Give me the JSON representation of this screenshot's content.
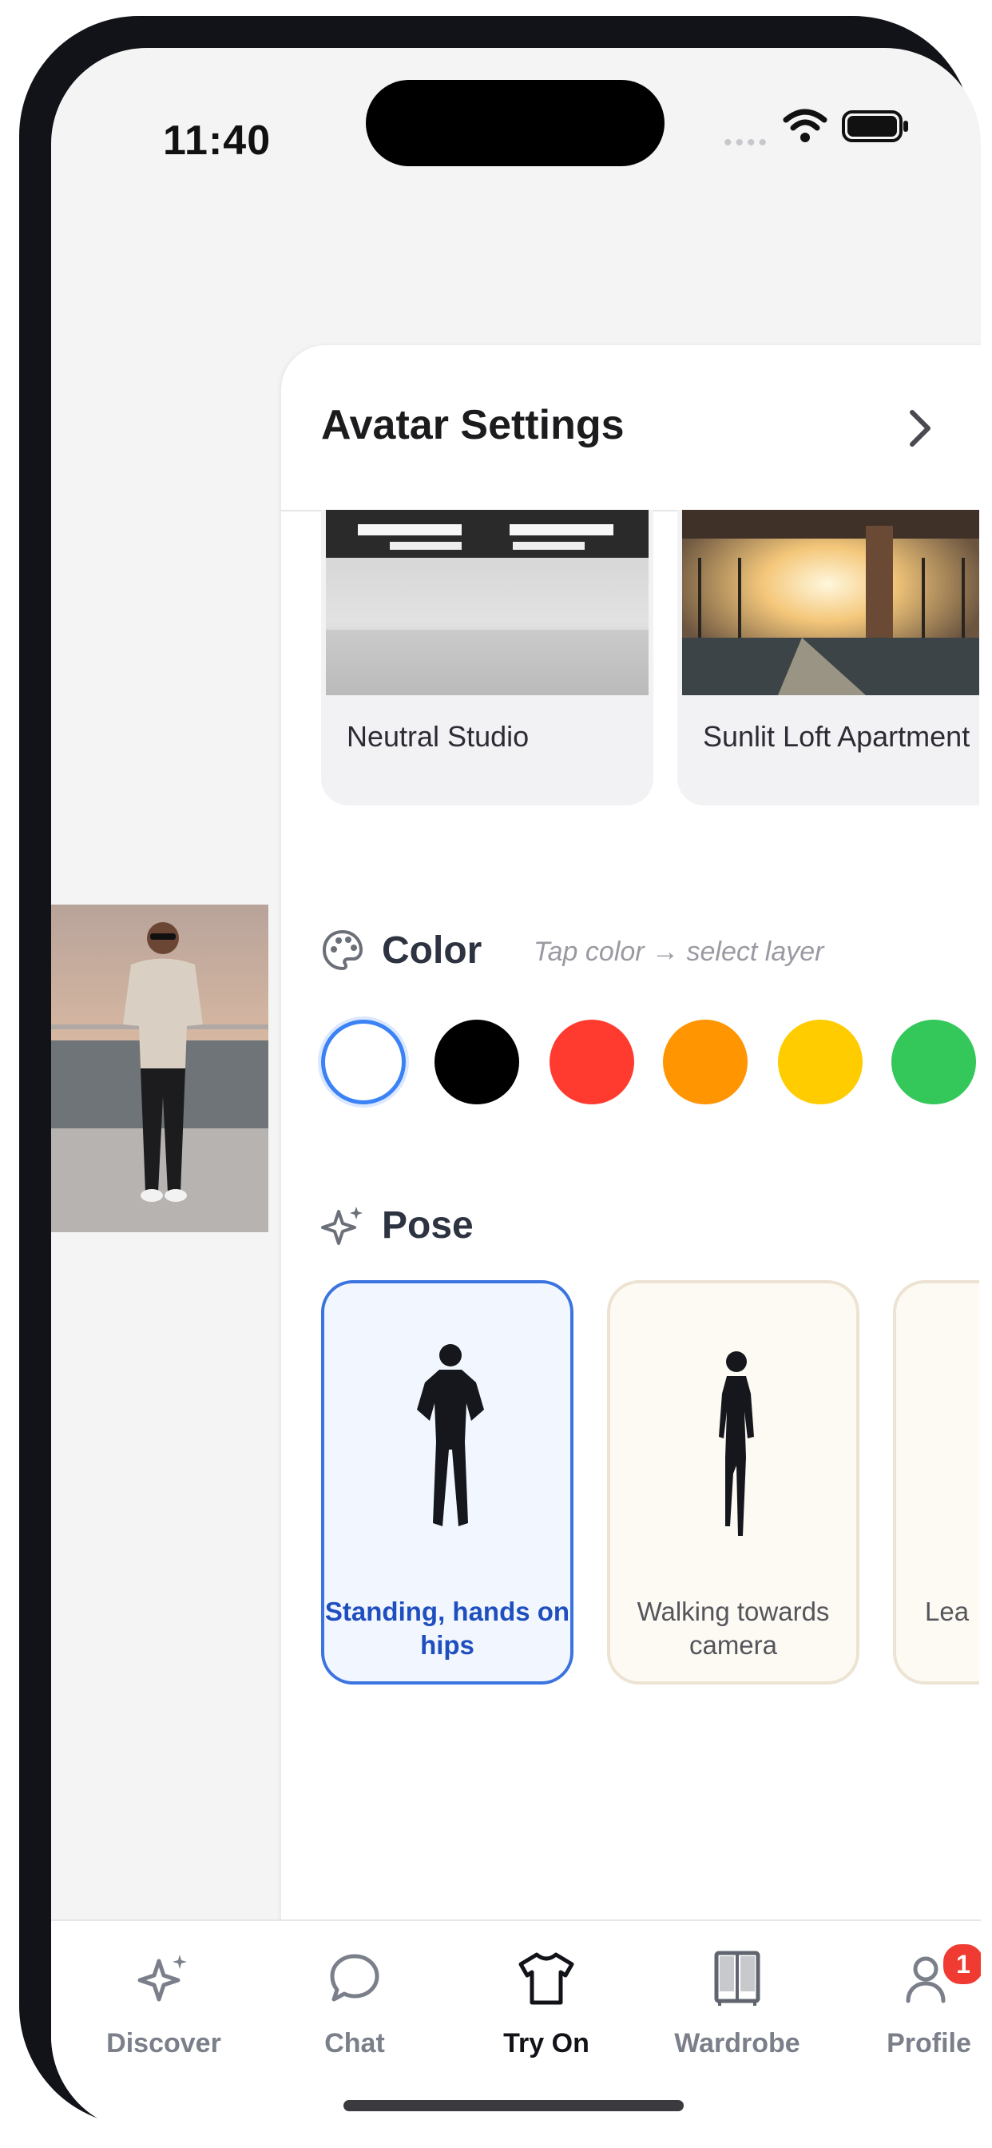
{
  "status_bar": {
    "time": "11:40"
  },
  "panel": {
    "title": "Avatar Settings",
    "backgrounds": [
      {
        "label": "Neutral Studio"
      },
      {
        "label": "Sunlit Loft Apartment"
      }
    ],
    "color": {
      "title": "Color",
      "hint": "Tap color → select layer",
      "swatches": [
        "#ffffff",
        "#000000",
        "#ff3b30",
        "#ff9500",
        "#ffcc00",
        "#34c759"
      ],
      "selected_index": 0
    },
    "pose": {
      "title": "Pose",
      "cards": [
        {
          "label": "Standing, hands on hips",
          "selected": true
        },
        {
          "label": "Walking towards camera",
          "selected": false
        },
        {
          "label": "Lea",
          "selected": false
        }
      ]
    }
  },
  "tabbar": {
    "tabs": [
      {
        "label": "Discover",
        "icon": "sparkle-icon"
      },
      {
        "label": "Chat",
        "icon": "chat-bubble-icon"
      },
      {
        "label": "Try On",
        "icon": "tshirt-icon",
        "active": true
      },
      {
        "label": "Wardrobe",
        "icon": "wardrobe-icon"
      },
      {
        "label": "Profile",
        "icon": "profile-icon",
        "badge": "1"
      }
    ]
  },
  "colors": {
    "accent": "#3b82f6",
    "badge": "#ef3b32"
  }
}
